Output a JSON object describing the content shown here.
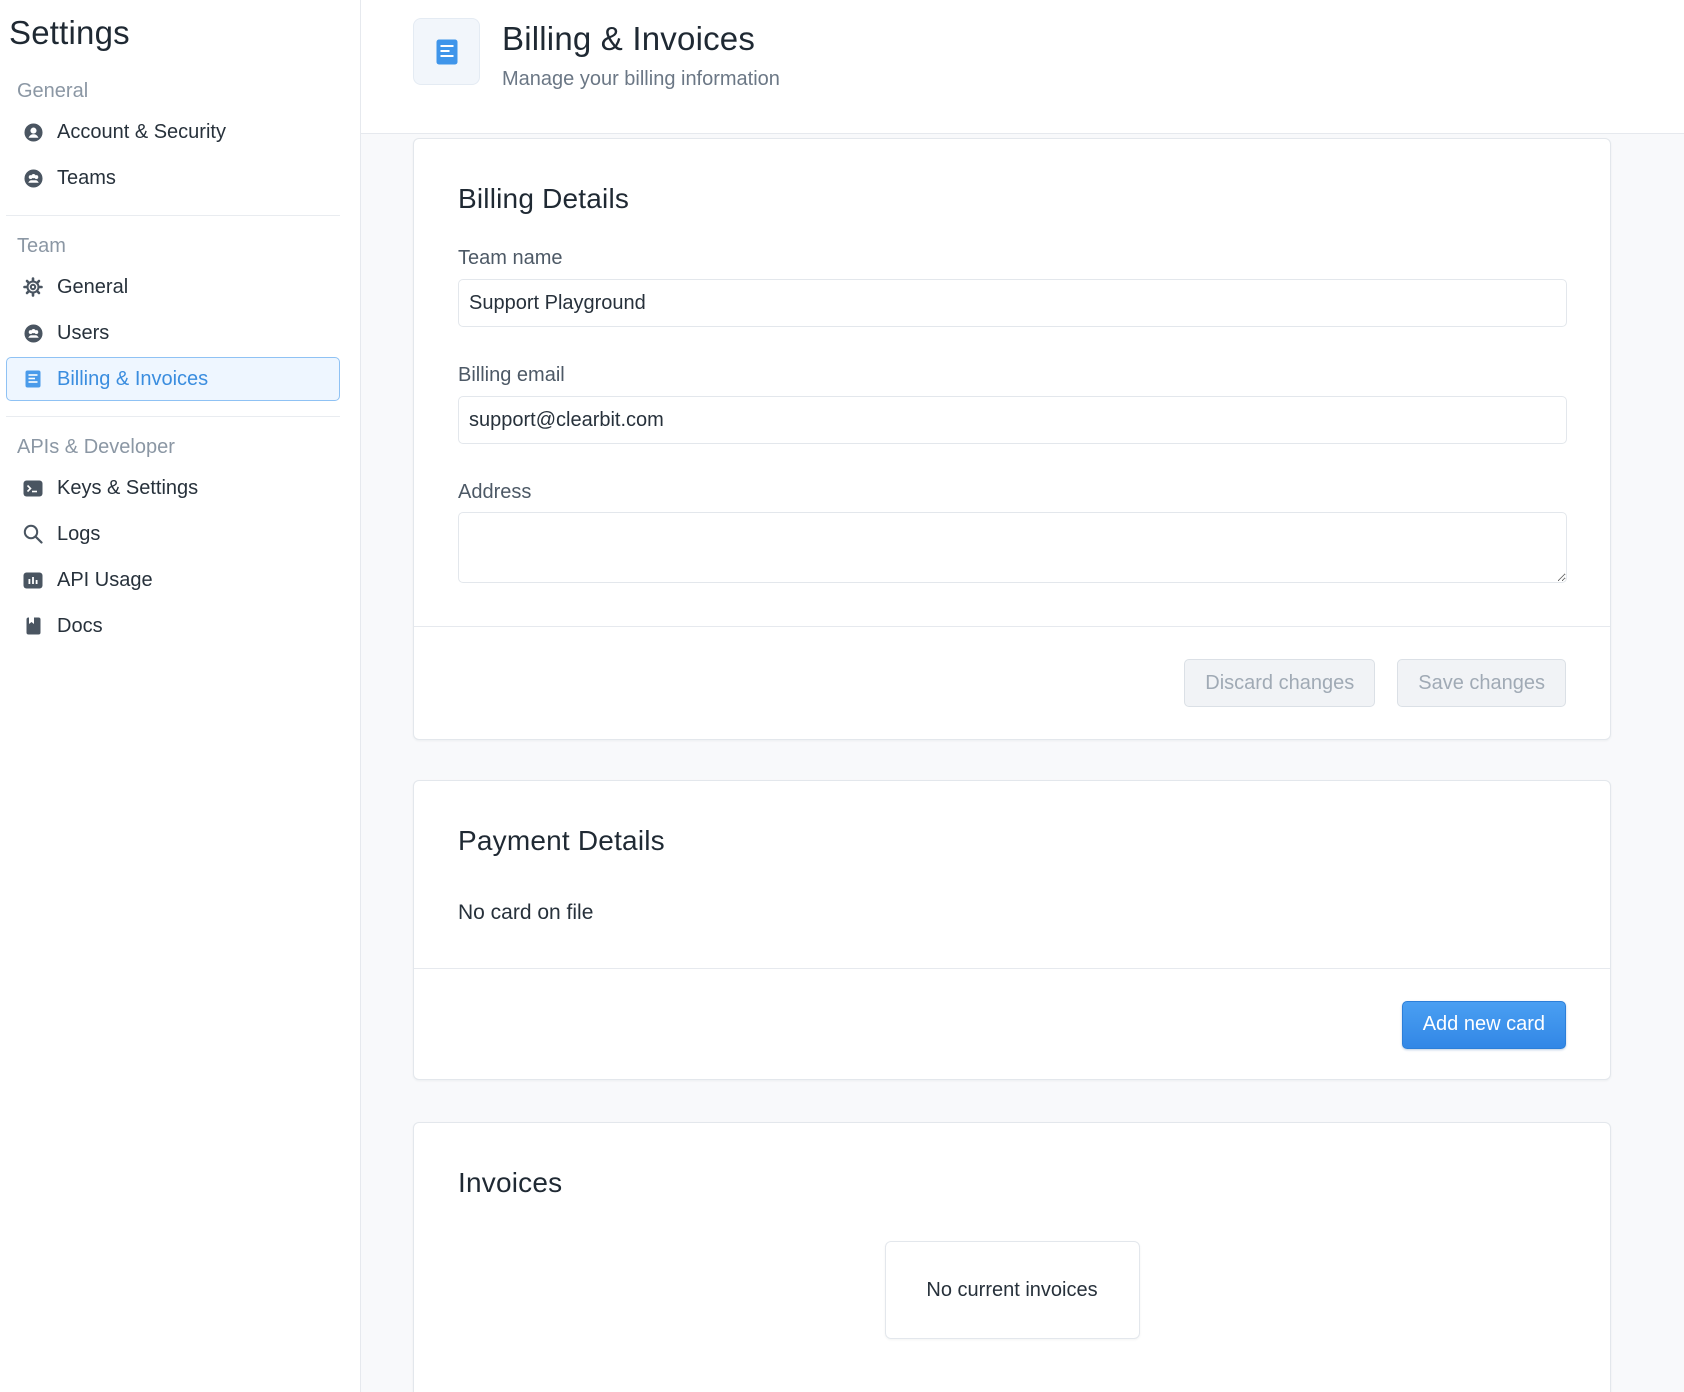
{
  "sidebar": {
    "title": "Settings",
    "sections": [
      {
        "heading": "General",
        "items": [
          {
            "label": "Account & Security",
            "icon": "user-circle-icon"
          },
          {
            "label": "Teams",
            "icon": "team-icon"
          }
        ]
      },
      {
        "heading": "Team",
        "items": [
          {
            "label": "General",
            "icon": "gear-icon"
          },
          {
            "label": "Users",
            "icon": "users-icon"
          },
          {
            "label": "Billing & Invoices",
            "icon": "document-icon",
            "active": true
          }
        ]
      },
      {
        "heading": "APIs & Developer",
        "items": [
          {
            "label": "Keys & Settings",
            "icon": "terminal-icon"
          },
          {
            "label": "Logs",
            "icon": "search-icon"
          },
          {
            "label": "API Usage",
            "icon": "bar-chart-icon"
          },
          {
            "label": "Docs",
            "icon": "book-icon"
          }
        ]
      }
    ]
  },
  "header": {
    "title": "Billing & Invoices",
    "subtitle": "Manage your billing information",
    "icon": "document-icon"
  },
  "billing_details": {
    "title": "Billing Details",
    "team_name_label": "Team name",
    "team_name_value": "Support Playground",
    "billing_email_label": "Billing email",
    "billing_email_value": "support@clearbit.com",
    "address_label": "Address",
    "address_value": "",
    "discard_label": "Discard changes",
    "save_label": "Save changes"
  },
  "payment_details": {
    "title": "Payment Details",
    "status_text": "No card on file",
    "add_card_label": "Add new card"
  },
  "invoices": {
    "title": "Invoices",
    "empty_text": "No current invoices"
  },
  "colors": {
    "accent": "#3a8ddf",
    "active_bg": "#eef6ff",
    "primary_button": "#3287e6"
  }
}
